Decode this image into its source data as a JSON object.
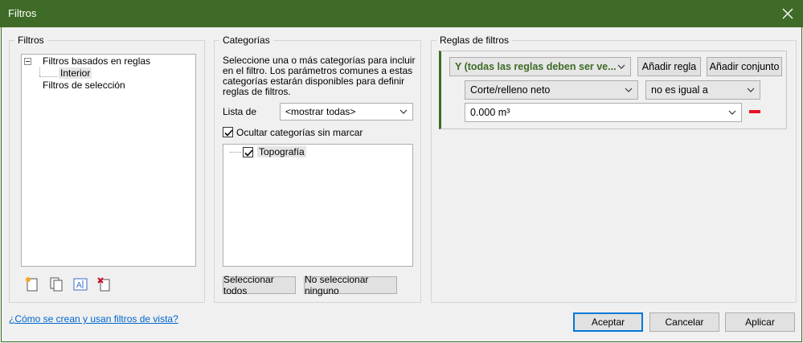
{
  "window": {
    "title": "Filtros"
  },
  "filters_panel": {
    "legend": "Filtros",
    "tree": {
      "rule_based": "Filtros basados en reglas",
      "rule_child": "Interior",
      "selection": "Filtros de selección"
    },
    "icons": [
      "new-filter-icon",
      "duplicate-filter-icon",
      "rename-filter-icon",
      "delete-filter-icon"
    ]
  },
  "categories_panel": {
    "legend": "Categorías",
    "description": "Seleccione una o más categorías para incluir en el filtro. Los parámetros comunes a estas categorías estarán disponibles para definir reglas de filtros.",
    "list_label": "Lista de",
    "list_value": "<mostrar todas>",
    "hide_unchecked_label": "Ocultar categorías sin marcar",
    "hide_unchecked_checked": true,
    "categories": [
      {
        "label": "Topografía",
        "checked": true
      }
    ],
    "select_all": "Seleccionar todos",
    "select_none": "No seleccionar ninguno"
  },
  "rules_panel": {
    "legend": "Reglas de filtros",
    "condition": "Y (todas las reglas deben ser ve...",
    "add_rule": "Añadir regla",
    "add_set": "Añadir conjunto",
    "parameter": "Corte/relleno neto",
    "operator": "no es igual a",
    "value": "0.000 m³",
    "accent_color": "#3e6b27",
    "remove_color": "#e81123"
  },
  "footer": {
    "help_link": "¿Cómo se crean y usan filtros de vista?",
    "ok": "Aceptar",
    "cancel": "Cancelar",
    "apply": "Aplicar"
  }
}
